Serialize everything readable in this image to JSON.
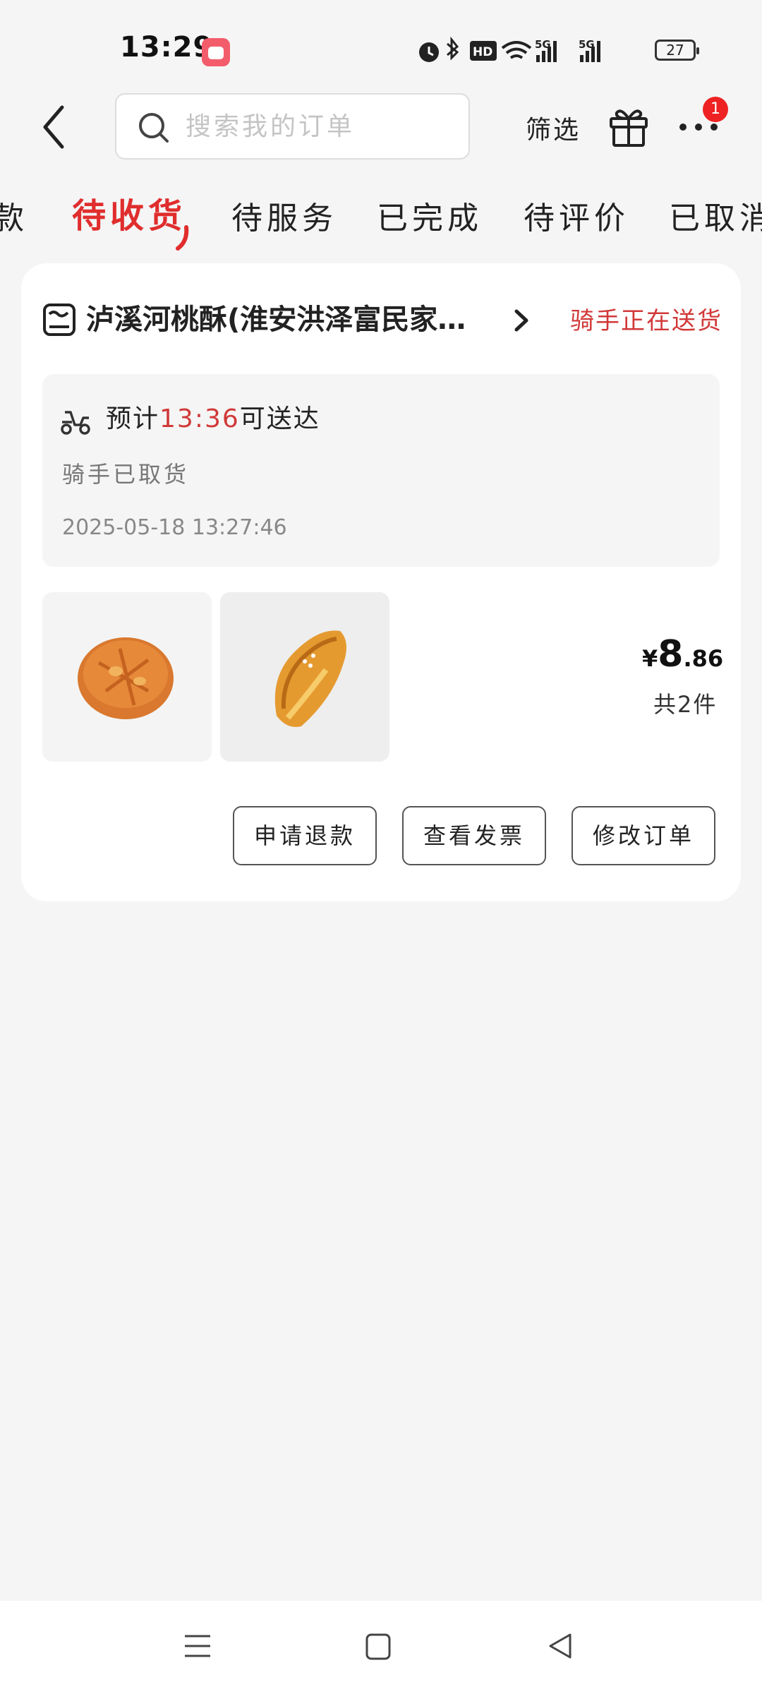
{
  "status_bar": {
    "time": "13:29",
    "battery": "27"
  },
  "header": {
    "search_placeholder": "搜索我的订单",
    "filter_label": "筛选",
    "notification_count": "1"
  },
  "tabs": [
    {
      "label": "款"
    },
    {
      "label": "待收货",
      "active": true
    },
    {
      "label": "待服务"
    },
    {
      "label": "已完成"
    },
    {
      "label": "待评价"
    },
    {
      "label": "已取消"
    }
  ],
  "order": {
    "store_name": "泸溪河桃酥(淮安洪泽富民家…",
    "status": "骑手正在送货",
    "eta_prefix": "预计",
    "eta_time": "13:36",
    "eta_suffix": "可送达",
    "rider_status": "骑手已取货",
    "timestamp": "2025-05-18 13:27:46",
    "price_currency": "¥",
    "price_integer": "8",
    "price_decimal": ".86",
    "item_count": "共2件",
    "actions": {
      "refund": "申请退款",
      "invoice": "查看发票",
      "modify": "修改订单"
    }
  },
  "colors": {
    "accent": "#e02d2d",
    "background": "#f5f5f5",
    "card": "#ffffff"
  },
  "icons": [
    "back-icon",
    "search-icon",
    "gift-icon",
    "more-icon",
    "store-icon",
    "chevron-right-icon",
    "scooter-icon",
    "menu-icon",
    "home-icon",
    "nav-back-icon"
  ]
}
